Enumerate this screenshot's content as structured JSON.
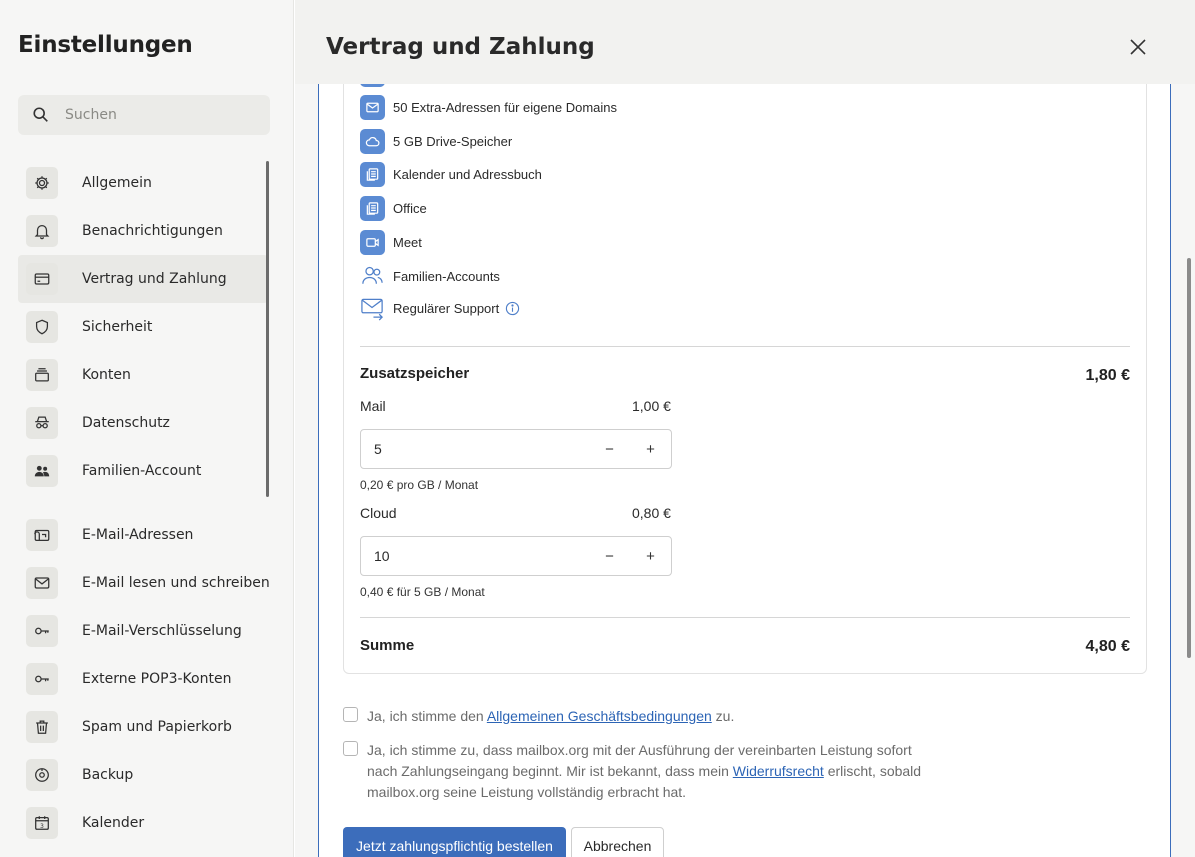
{
  "sidebar": {
    "title": "Einstellungen",
    "search_placeholder": "Suchen",
    "items": [
      {
        "label": "Allgemein",
        "icon": "gear-icon"
      },
      {
        "label": "Benachrichtigungen",
        "icon": "bell-icon"
      },
      {
        "label": "Vertrag und Zahlung",
        "icon": "credit-card-icon",
        "active": true
      },
      {
        "label": "Sicherheit",
        "icon": "shield-icon"
      },
      {
        "label": "Konten",
        "icon": "stack-icon"
      },
      {
        "label": "Datenschutz",
        "icon": "incognito-icon"
      },
      {
        "label": "Familien-Account",
        "icon": "users-icon"
      },
      {
        "label": "E-Mail-Adressen",
        "icon": "mailbox-icon"
      },
      {
        "label": "E-Mail lesen und schreiben",
        "icon": "envelope-icon"
      },
      {
        "label": "E-Mail-Verschlüsselung",
        "icon": "key-icon"
      },
      {
        "label": "Externe POP3-Konten",
        "icon": "key-icon"
      },
      {
        "label": "Spam und Papierkorb",
        "icon": "trash-icon"
      },
      {
        "label": "Backup",
        "icon": "backup-icon"
      },
      {
        "label": "Kalender",
        "icon": "calendar-icon"
      }
    ]
  },
  "header": {
    "title": "Vertrag und Zahlung",
    "close_icon": "close-icon"
  },
  "features": [
    {
      "label": "50 Extra-Adressen für eigene Domains",
      "icon": "envelope-icon"
    },
    {
      "label": "5 GB Drive-Speicher",
      "icon": "cloud-icon"
    },
    {
      "label": "Kalender und Adressbuch",
      "icon": "documents-icon"
    },
    {
      "label": "Office",
      "icon": "documents-icon"
    },
    {
      "label": "Meet",
      "icon": "video-icon"
    },
    {
      "label": "Familien-Accounts",
      "icon": "users-icon"
    },
    {
      "label": "Regulärer Support",
      "icon": "mail-forward-icon"
    }
  ],
  "storage": {
    "title": "Zusatzspeicher",
    "total": "1,80 €",
    "mail": {
      "label": "Mail",
      "price": "1,00 €",
      "value": "5",
      "hint": "0,20 € pro GB / Monat"
    },
    "cloud": {
      "label": "Cloud",
      "price": "0,80 €",
      "value": "10",
      "hint": "0,40 € für 5 GB / Monat"
    },
    "minus": "−",
    "plus": "+"
  },
  "summary": {
    "label": "Summe",
    "amount": "4,80 €"
  },
  "consent": {
    "agb_prefix": "Ja, ich stimme den ",
    "agb_link": "Allgemeinen Geschäftsbedingungen",
    "agb_suffix": " zu.",
    "revocation_prefix": "Ja, ich stimme zu, dass mailbox.org mit der Ausführung der vereinbarten Leistung sofort nach Zahlungseingang beginnt. Mir ist bekannt, dass mein ",
    "revocation_link": "Widerrufsrecht",
    "revocation_suffix": " erlischt, sobald mailbox.org seine Leistung vollständig erbracht hat."
  },
  "actions": {
    "order": "Jetzt zahlungspflichtig bestellen",
    "cancel": "Abbrechen"
  }
}
